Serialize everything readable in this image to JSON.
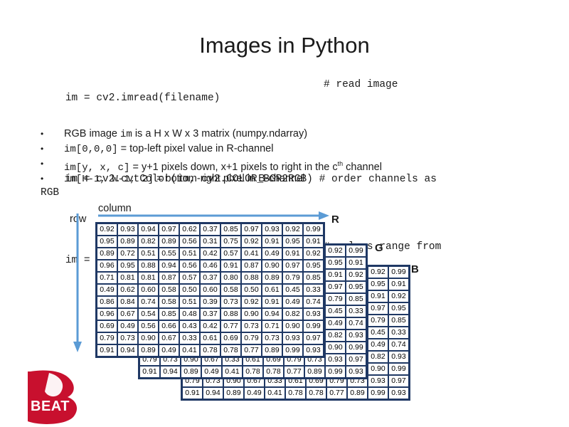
{
  "slide": {
    "title": "Images in Python"
  },
  "code": {
    "lines": [
      {
        "code": "im = cv2.imread(filename)",
        "comment": "# read image"
      },
      {
        "code": "im = cv2.cvtColor(im, cv2.COLOR_BGR2RGB) # order channels as\nRGB",
        "comment": ""
      },
      {
        "code": "im = im / 255",
        "comment": "# values range from\n0 to 1"
      }
    ]
  },
  "bullets": [
    {
      "marker": "•",
      "pre": "RGB image ",
      "mono1": "im",
      "mid": " is a H x W x 3 matrix (numpy.ndarray)",
      "mono2": "",
      "post": ""
    },
    {
      "marker": "•",
      "pre": "",
      "mono1": "im[0,0,0]",
      "mid": " = top-left pixel value in R-channel",
      "mono2": "",
      "post": ""
    },
    {
      "marker": "•",
      "pre": "",
      "mono1": "im[y, x, c]",
      "mid": " = y+1 pixels down, x+1 pixels to right in the c",
      "sup": "th",
      "post": " channel"
    },
    {
      "marker": "•",
      "pre": "",
      "mono1": "im[H-1, W-1, 2]",
      "mid": " = bottom-right pixel in B-channel",
      "mono2": "",
      "post": ""
    }
  ],
  "axes": {
    "column_label": "column",
    "row_label": "row",
    "arrow_color": "#5b9bd5"
  },
  "planes": [
    {
      "name": "R",
      "label": "R",
      "rows": [
        [
          "0.92",
          "0.93",
          "0.94",
          "0.97",
          "0.62",
          "0.37",
          "0.85",
          "0.97",
          "0.93",
          "0.92",
          "0.99"
        ],
        [
          "0.95",
          "0.89",
          "0.82",
          "0.89",
          "0.56",
          "0.31",
          "0.75",
          "0.92",
          "0.91",
          "0.95",
          "0.91"
        ],
        [
          "0.89",
          "0.72",
          "0.51",
          "0.55",
          "0.51",
          "0.42",
          "0.57",
          "0.41",
          "0.49",
          "0.91",
          "0.92"
        ],
        [
          "0.96",
          "0.95",
          "0.88",
          "0.94",
          "0.56",
          "0.46",
          "0.91",
          "0.87",
          "0.90",
          "0.97",
          "0.95"
        ],
        [
          "0.71",
          "0.81",
          "0.81",
          "0.87",
          "0.57",
          "0.37",
          "0.80",
          "0.88",
          "0.89",
          "0.79",
          "0.85"
        ],
        [
          "0.49",
          "0.62",
          "0.60",
          "0.58",
          "0.50",
          "0.60",
          "0.58",
          "0.50",
          "0.61",
          "0.45",
          "0.33"
        ],
        [
          "0.86",
          "0.84",
          "0.74",
          "0.58",
          "0.51",
          "0.39",
          "0.73",
          "0.92",
          "0.91",
          "0.49",
          "0.74"
        ],
        [
          "0.96",
          "0.67",
          "0.54",
          "0.85",
          "0.48",
          "0.37",
          "0.88",
          "0.90",
          "0.94",
          "0.82",
          "0.93"
        ],
        [
          "0.69",
          "0.49",
          "0.56",
          "0.66",
          "0.43",
          "0.42",
          "0.77",
          "0.73",
          "0.71",
          "0.90",
          "0.99"
        ],
        [
          "0.79",
          "0.73",
          "0.90",
          "0.67",
          "0.33",
          "0.61",
          "0.69",
          "0.79",
          "0.73",
          "0.93",
          "0.97"
        ],
        [
          "0.91",
          "0.94",
          "0.89",
          "0.49",
          "0.41",
          "0.78",
          "0.78",
          "0.77",
          "0.89",
          "0.99",
          "0.93"
        ]
      ]
    },
    {
      "name": "G",
      "label": "G",
      "rows": [
        [
          "0.92",
          "0.99"
        ],
        [
          "0.95",
          "0.91"
        ],
        [
          "0.91",
          "0.92"
        ],
        [
          "0.97",
          "0.95"
        ],
        [
          "0.79",
          "0.85"
        ],
        [
          "0.45",
          "0.33"
        ],
        [
          "0.49",
          "0.74"
        ],
        [
          "0.82",
          "0.93"
        ],
        [
          "0.90",
          "0.99"
        ],
        [
          "0.79",
          "0.73",
          "0.90",
          "0.67",
          "0.33",
          "0.61",
          "0.69",
          "0.79",
          "0.73",
          "0.93",
          "0.97"
        ],
        [
          "0.91",
          "0.94",
          "0.89",
          "0.49",
          "0.41",
          "0.78",
          "0.78",
          "0.77",
          "0.89",
          "0.99",
          "0.93"
        ]
      ]
    },
    {
      "name": "B",
      "label": "B",
      "rows": [
        [
          "0.92",
          "0.99"
        ],
        [
          "0.95",
          "0.91"
        ],
        [
          "0.91",
          "0.92"
        ],
        [
          "0.97",
          "0.95"
        ],
        [
          "0.79",
          "0.85"
        ],
        [
          "0.45",
          "0.33"
        ],
        [
          "0.49",
          "0.74"
        ],
        [
          "0.82",
          "0.93"
        ],
        [
          "0.90",
          "0.99"
        ],
        [
          "0.79",
          "0.73",
          "0.90",
          "0.67",
          "0.33",
          "0.61",
          "0.69",
          "0.79",
          "0.73",
          "0.93",
          "0.97"
        ],
        [
          "0.91",
          "0.94",
          "0.89",
          "0.49",
          "0.41",
          "0.78",
          "0.78",
          "0.77",
          "0.89",
          "0.99",
          "0.93"
        ]
      ]
    }
  ],
  "logo": {
    "text": "BEAT",
    "color": "#c8102e"
  }
}
